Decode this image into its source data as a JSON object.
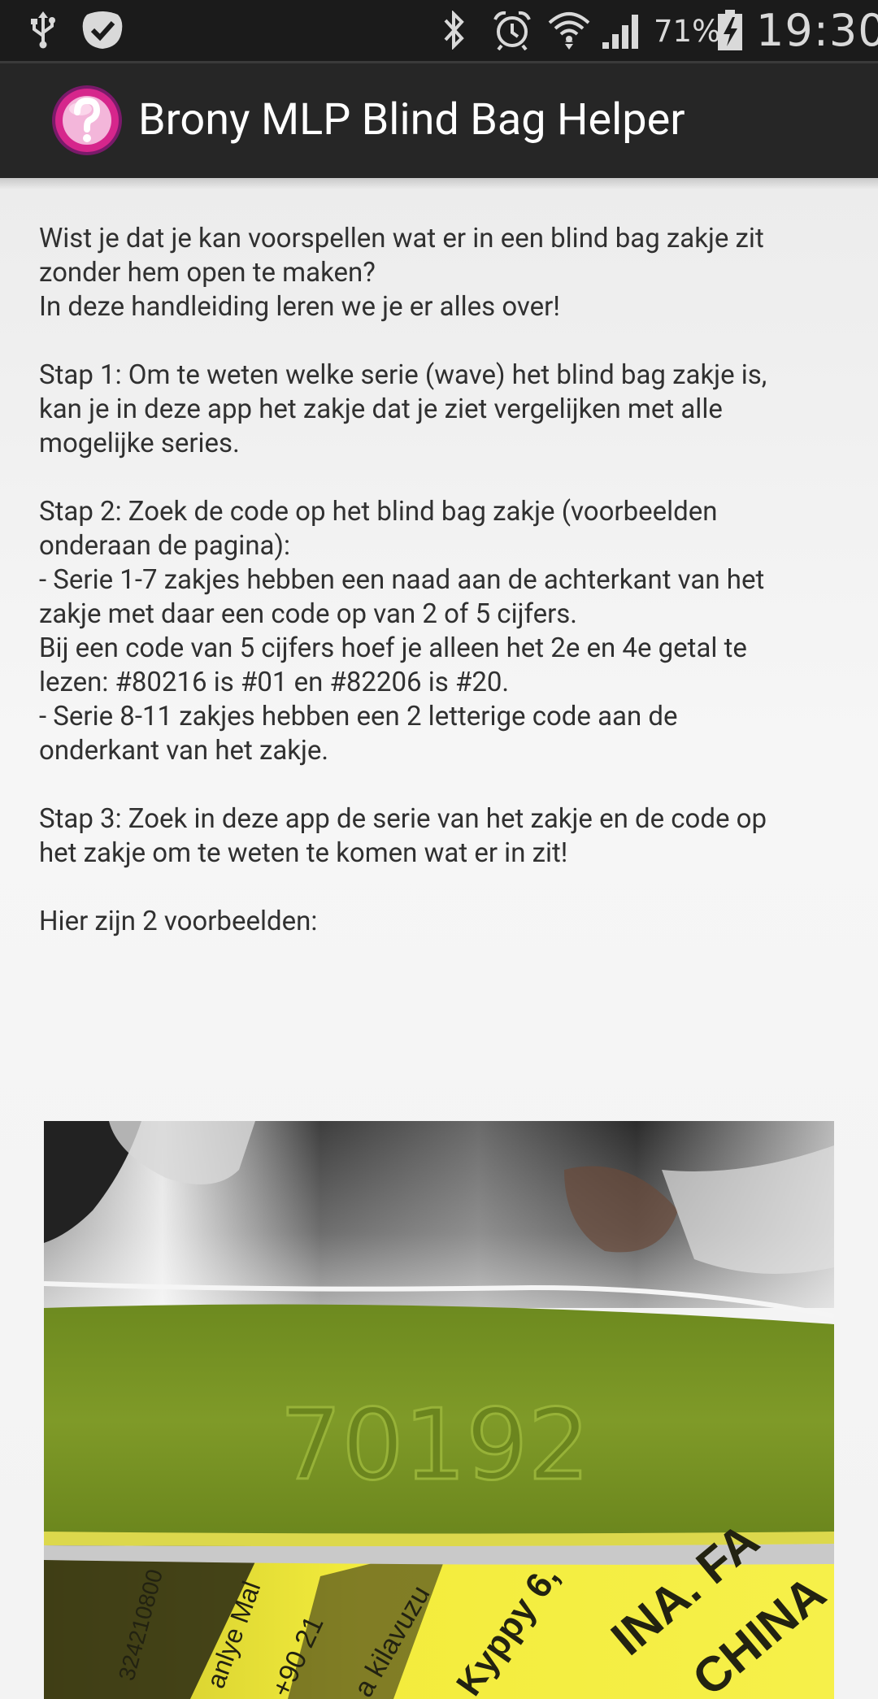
{
  "status_bar": {
    "icons": [
      "usb-icon",
      "check-badge-icon",
      "bluetooth-icon",
      "alarm-icon",
      "wifi-icon",
      "signal-icon",
      "battery-charging-icon"
    ],
    "battery_percent": "71%",
    "time": "19:30",
    "bar_color": "#1b1b1b",
    "text_color": "#d9d9d9"
  },
  "action_bar": {
    "icon": "question-mark-app-icon",
    "title": "Brony MLP Blind Bag Helper",
    "bar_color": "#262626",
    "icon_color": "#d6268c"
  },
  "intro": {
    "lines": [
      "Wist je dat je kan voorspellen wat er in een blind bag zakje zit",
      "zonder hem open te maken?",
      "In deze handleiding leren we je er alles over!"
    ]
  },
  "step1": {
    "lines": [
      "Stap 1: Om te weten welke serie (wave) het blind bag zakje is,",
      "kan je in deze app het zakje dat je ziet vergelijken met alle",
      "mogelijke series."
    ]
  },
  "step2": {
    "lines": [
      "Stap 2: Zoek de code op het blind bag zakje (voorbeelden",
      "onderaan de pagina):",
      "- Serie 1-7 zakjes hebben een naad aan de achterkant van het",
      "zakje met daar een code op van 2 of 5 cijfers.",
      "Bij een code van 5 cijfers hoef je alleen het 2e en 4e getal te",
      "lezen: #80216 is #01 en #82206 is #20.",
      "- Serie 8-11 zakjes hebben een 2 letterige code aan de",
      "onderkant van het zakje."
    ]
  },
  "step3": {
    "lines": [
      "Stap 3: Zoek in deze app de serie van het zakje en de code op",
      "het zakje om te weten te komen wat er in zit!"
    ]
  },
  "examples": {
    "heading": "Hier zijn 2 voorbeelden:",
    "photo": {
      "embossed_code": "70192",
      "print_fragments": [
        "INA. FA",
        "CHINA",
        "Kyppy 6,",
        "a kilavuzu",
        "+90 21",
        "anlye Mal",
        "324210800"
      ],
      "colors": {
        "seam_green": "#7f9a28",
        "label_yellow": "#f3ec3c",
        "foil_silver": "#c8c8c8"
      }
    }
  }
}
